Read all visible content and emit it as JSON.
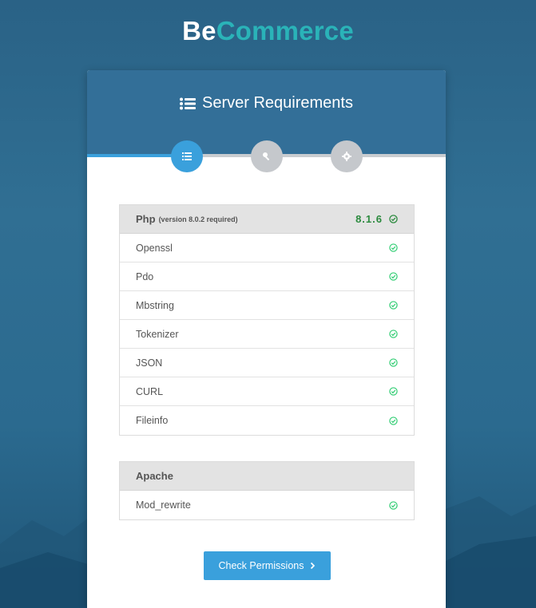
{
  "brand": {
    "part1": "Be",
    "part2": "Commerce"
  },
  "card": {
    "title": "Server Requirements",
    "steps": [
      {
        "icon": "list-icon",
        "active": true
      },
      {
        "icon": "key-icon",
        "active": false
      },
      {
        "icon": "gear-icon",
        "active": false
      }
    ]
  },
  "php": {
    "label": "Php",
    "requirement": "(version 8.0.2 required)",
    "version": "8.1.6",
    "extensions": [
      "Openssl",
      "Pdo",
      "Mbstring",
      "Tokenizer",
      "JSON",
      "CURL",
      "Fileinfo"
    ]
  },
  "apache": {
    "label": "Apache",
    "modules": [
      "Mod_rewrite"
    ]
  },
  "actions": {
    "check_permissions": "Check Permissions"
  },
  "colors": {
    "accent": "#3aa0dc",
    "header": "#336f98",
    "brand_teal": "#2ab3b8",
    "success": "#2b8a3e"
  }
}
